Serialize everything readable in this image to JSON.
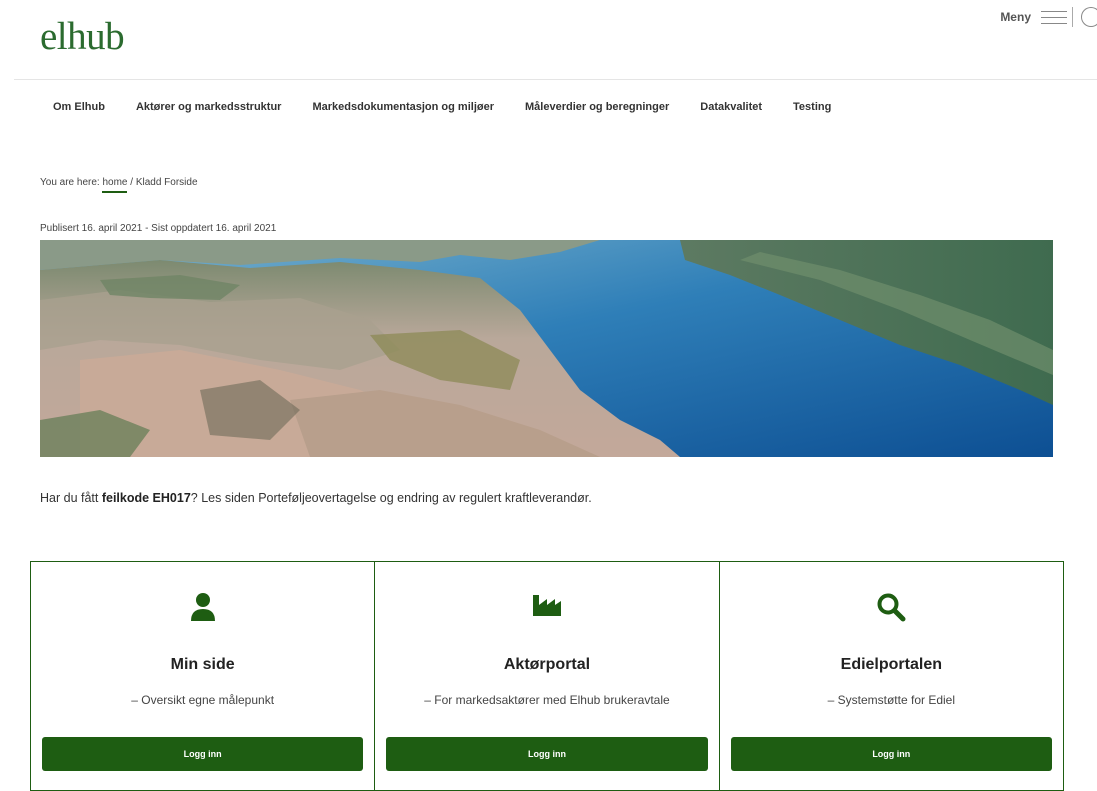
{
  "header": {
    "logo": "elhub",
    "menu_label": "Meny",
    "icons": [
      "hamburger-icon",
      "search-icon"
    ]
  },
  "nav": {
    "items": [
      {
        "label": "Om Elhub"
      },
      {
        "label": "Aktører og markedsstruktur"
      },
      {
        "label": "Markedsdokumentasjon og miljøer"
      },
      {
        "label": "Måleverdier og beregninger"
      },
      {
        "label": "Datakvalitet"
      },
      {
        "label": "Testing"
      }
    ]
  },
  "breadcrumb": {
    "prefix": "You are here: ",
    "home": "home",
    "separator": " / ",
    "current": "Kladd Forside"
  },
  "meta": {
    "published": "Publisert 16. april 2021 - Sist oppdatert 16. april 2021"
  },
  "notice": {
    "before": "Har du fått ",
    "bold": "feilkode EH017",
    "after": "? Les siden Porteføljeovertagelse og endring av regulert kraftleverandør."
  },
  "cards": [
    {
      "icon": "user-icon",
      "title": "Min side",
      "subtitle": "– Oversikt egne målepunkt",
      "button": "Logg inn"
    },
    {
      "icon": "factory-icon",
      "title": "Aktørportal",
      "subtitle": "– For markedsaktører med Elhub brukeravtale",
      "button": "Logg inn"
    },
    {
      "icon": "search-icon",
      "title": "Edielportalen",
      "subtitle": "– Systemstøtte for Ediel",
      "button": "Logg inn"
    }
  ],
  "colors": {
    "brand_green": "#1e5d12",
    "logo_green": "#2b6b2f"
  }
}
